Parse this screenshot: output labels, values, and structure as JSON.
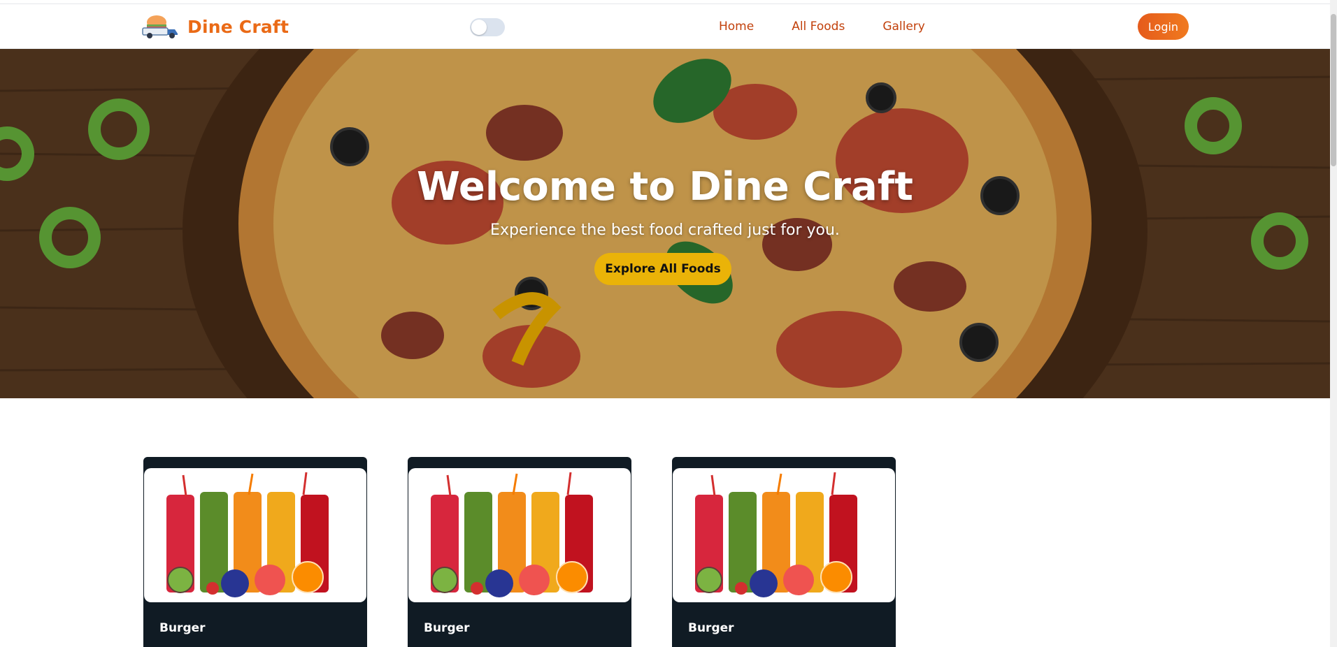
{
  "navbar": {
    "brand_name": "Dine Craft",
    "logo_icon": "food-truck-burger-icon",
    "links": [
      {
        "label": "Home"
      },
      {
        "label": "All Foods"
      },
      {
        "label": "Gallery"
      }
    ],
    "login_label": "Login",
    "theme_toggle": {
      "state": "off"
    }
  },
  "hero": {
    "title": "Welcome to Dine Craft",
    "subtitle": "Experience the best food crafted just for you.",
    "cta_label": "Explore All Foods"
  },
  "cards": [
    {
      "title": "Burger"
    },
    {
      "title": "Burger"
    },
    {
      "title": "Burger"
    }
  ],
  "colors": {
    "brand": "#ea6a16",
    "nav_link": "#c2410c",
    "cta": "#eab308",
    "card_bg": "#101b24"
  }
}
